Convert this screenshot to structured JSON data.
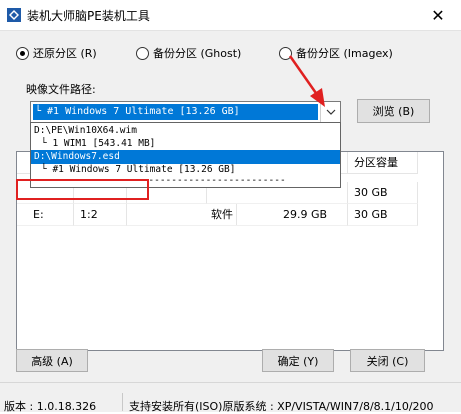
{
  "window": {
    "title": "装机大师脑PE装机工具",
    "close_glyph": "✕"
  },
  "modes": [
    {
      "label": "还原分区 (R)",
      "checked": true
    },
    {
      "label": "备份分区 (Ghost)",
      "checked": false
    },
    {
      "label": "备份分区 (Imagex)",
      "checked": false
    }
  ],
  "image_path": {
    "label": "映像文件路径:",
    "selected": "└ #1 Windows 7 Ultimate [13.26 GB]",
    "browse_label": "浏览 (B)",
    "dropdown_options": [
      "D:\\PE\\Win10X64.wim",
      "└ 1 WIM1 [543.41 MB]",
      "D:\\Windows7.esd",
      "└ #1 Windows 7 Ultimate [13.26 GB]",
      "--------------------------------------------"
    ]
  },
  "table": {
    "columns": [
      "",
      "",
      "",
      "",
      "分区容量"
    ],
    "rows": [
      [
        "",
        "",
        "",
        "",
        "30 GB"
      ],
      [
        "E:",
        "1:2",
        "软件",
        "29.9 GB",
        "30 GB"
      ]
    ]
  },
  "buttons": {
    "advanced": "高级 (A)",
    "ok": "确定 (Y)",
    "close": "关闭 (C)"
  },
  "status": {
    "version": "版本 : 1.0.18.326",
    "support": "支持安装所有(ISO)原版系统 : XP/VISTA/WIN7/8/8.1/10/200"
  },
  "colors": {
    "selection": "#0078d7",
    "highlight": "#e02020",
    "face": "#f0f0f0"
  }
}
